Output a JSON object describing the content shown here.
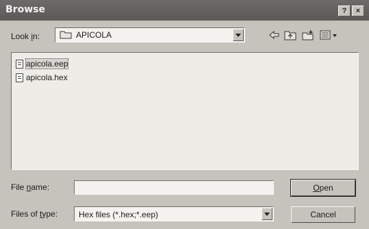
{
  "window": {
    "title": "Browse",
    "help_button": "?",
    "close_button": "×"
  },
  "lookin": {
    "label_pre": "Look ",
    "label_key": "i",
    "label_post": "n:",
    "value": "APICOLA"
  },
  "files": [
    {
      "name": "apicola.eep"
    },
    {
      "name": "apicola.hex"
    }
  ],
  "filename": {
    "label_pre": "File ",
    "label_key": "n",
    "label_post": "ame:",
    "value": ""
  },
  "filetype": {
    "label_pre": "Files of ",
    "label_key": "t",
    "label_post": "ype:",
    "value": "Hex files (*.hex;*.eep)"
  },
  "buttons": {
    "open_key": "O",
    "open_rest": "pen",
    "cancel": "Cancel"
  },
  "icons": {
    "back": "back-arrow-icon",
    "up": "up-folder-icon",
    "new_folder": "new-folder-icon",
    "view_menu": "view-menu-icon"
  }
}
